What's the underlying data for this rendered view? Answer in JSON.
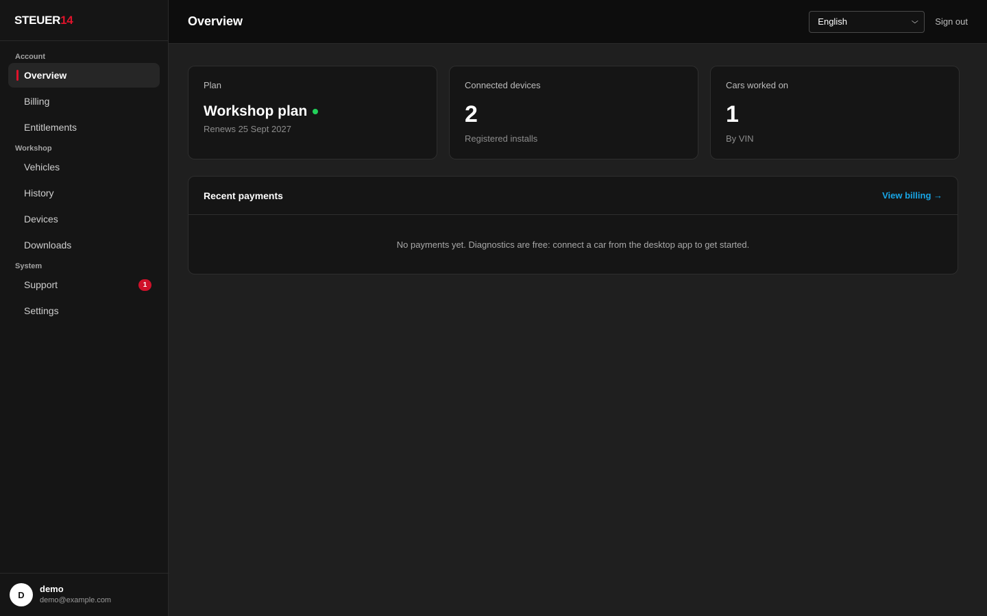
{
  "brand": {
    "part1": "STEUER",
    "part2": "14"
  },
  "sidebar": {
    "sections": [
      {
        "label": "Account",
        "items": [
          {
            "label": "Overview",
            "active": true
          },
          {
            "label": "Billing"
          },
          {
            "label": "Entitlements"
          }
        ]
      },
      {
        "label": "Workshop",
        "items": [
          {
            "label": "Vehicles"
          },
          {
            "label": "History"
          },
          {
            "label": "Devices"
          },
          {
            "label": "Downloads"
          }
        ]
      },
      {
        "label": "System",
        "items": [
          {
            "label": "Support",
            "badge": "1"
          },
          {
            "label": "Settings"
          }
        ]
      }
    ],
    "user": {
      "initial": "D",
      "name": "demo",
      "email": "demo@example.com"
    }
  },
  "header": {
    "title": "Overview",
    "language": "English",
    "sign_out": "Sign out"
  },
  "cards": {
    "plan": {
      "label": "Plan",
      "title": "Workshop plan",
      "status_color": "#22d05a",
      "sub": "Renews 25 Sept 2027"
    },
    "devices": {
      "label": "Connected devices",
      "value": "2",
      "sub": "Registered installs"
    },
    "cars": {
      "label": "Cars worked on",
      "value": "1",
      "sub": "By VIN"
    }
  },
  "payments": {
    "title": "Recent payments",
    "link": "View billing →",
    "empty": "No payments yet. Diagnostics are free: connect a car from the desktop app to get started."
  },
  "colors": {
    "accent": "#e0132b",
    "link": "#18a6e6",
    "success": "#22d05a"
  }
}
